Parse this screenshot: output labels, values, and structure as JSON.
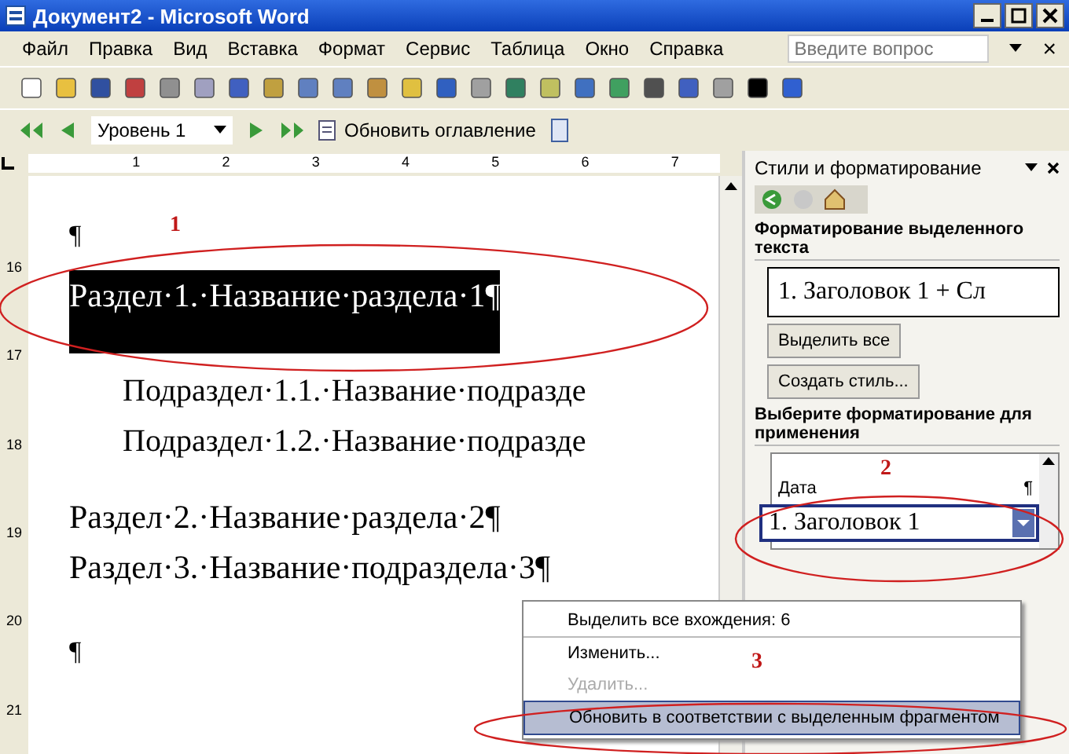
{
  "window": {
    "title": "Документ2 - Microsoft Word"
  },
  "menu_bar": {
    "items": [
      "Файл",
      "Правка",
      "Вид",
      "Вставка",
      "Формат",
      "Сервис",
      "Таблица",
      "Окно",
      "Справка"
    ],
    "help_field": {
      "placeholder": "Введите вопрос"
    },
    "close_glyph": "×"
  },
  "outline_toolbar": {
    "level_combo": "Уровень 1",
    "update_button": "Обновить оглавление"
  },
  "ruler": {
    "horizontal": [
      "1",
      "2",
      "3",
      "4",
      "5",
      "6",
      "7"
    ],
    "vertical": [
      "16",
      "17",
      "18",
      "19",
      "20",
      "21"
    ]
  },
  "document": {
    "lines": [
      {
        "kind": "mark",
        "text": "¶",
        "selected": false
      },
      {
        "kind": "heading",
        "text": "Раздел·1.·Название·раздела·1¶",
        "selected": true
      },
      {
        "kind": "sub",
        "text": "Подраздел·1.1.·Название·подразде",
        "selected": false
      },
      {
        "kind": "sub",
        "text": "Подраздел·1.2.·Название·подразде",
        "selected": false
      },
      {
        "kind": "heading",
        "text": "Раздел·2.·Название·раздела·2¶",
        "selected": false
      },
      {
        "kind": "heading",
        "text": "Раздел·3.·Название·подраздела·3¶",
        "selected": false
      },
      {
        "kind": "mark",
        "text": "¶",
        "selected": false
      }
    ]
  },
  "task_pane": {
    "title": "Стили и форматирование",
    "current_heading": "Форматирование выделенного текста",
    "current_style": "1.  Заголовок 1 + Сл",
    "select_all_button": "Выделить все",
    "new_style_button": "Создать стиль...",
    "apply_heading": "Выберите форматирование для применения",
    "styles": [
      {
        "name": "Дата",
        "mark": "¶",
        "selected": false
      },
      {
        "name": "1.  Заголовок 1",
        "selected": true
      }
    ]
  },
  "context_menu": {
    "items": [
      {
        "label": "Выделить все вхождения: 6",
        "disabled": false,
        "selected": false
      },
      {
        "label": "Изменить...",
        "disabled": false,
        "selected": false
      },
      {
        "label": "Удалить...",
        "disabled": true,
        "selected": false
      },
      {
        "label": "Обновить в соответствии с выделенным фрагментом",
        "disabled": false,
        "selected": true
      }
    ]
  },
  "annotations": [
    {
      "label": "1"
    },
    {
      "label": "2"
    },
    {
      "label": "3"
    }
  ]
}
